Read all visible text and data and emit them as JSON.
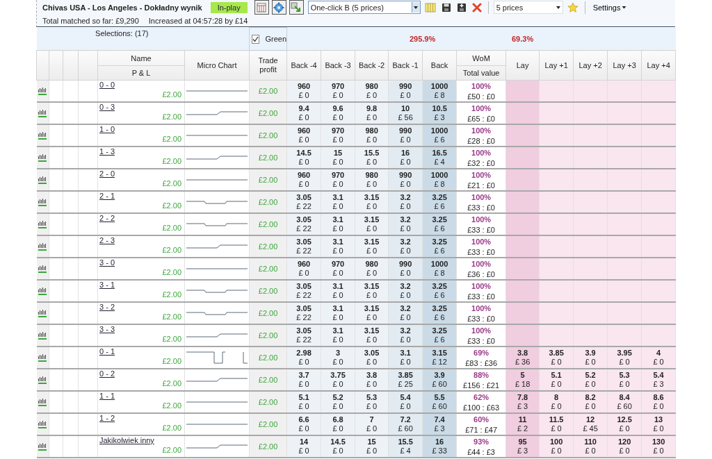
{
  "header": {
    "title": "Chivas USA - Los Angeles - Dokładny wynik",
    "status": "In-play",
    "strategy": "One-click B (5 prices)",
    "prices": "5 prices",
    "settings": "Settings",
    "total_matched": "Total matched so far: £9,290",
    "increased": "Increased at 04:57:28 by £14"
  },
  "summary": {
    "selections": "Selections: (17)",
    "green": {
      "label": "Green",
      "checked": true
    },
    "back_book": "295.9%",
    "lay_book": "69.3%"
  },
  "columns": {
    "name": "Name",
    "pl": "P & L",
    "micro_chart": "Micro Chart",
    "trade_profit": "Trade profit",
    "back": [
      "Back -4",
      "Back -3",
      "Back -2",
      "Back -1",
      "Back"
    ],
    "wom": "WoM",
    "total_value": "Total value",
    "lay": [
      "Lay",
      "Lay +1",
      "Lay +2",
      "Lay +3",
      "Lay +4"
    ]
  },
  "rows": [
    {
      "name": "0 - 0",
      "pl": "£2.00",
      "kind": "flat",
      "trade_profit": "£2.00",
      "back": [
        [
          "960",
          "£ 0"
        ],
        [
          "970",
          "£ 0"
        ],
        [
          "980",
          "£ 0"
        ],
        [
          "990",
          "£ 0"
        ],
        [
          "1000",
          "£ 8"
        ]
      ],
      "wom": "100%",
      "total": "£50 : £0"
    },
    {
      "name": "0 - 3",
      "pl": "£2.00",
      "kind": "step",
      "trade_profit": "£2.00",
      "back": [
        [
          "9.4",
          "£ 0"
        ],
        [
          "9.6",
          "£ 0"
        ],
        [
          "9.8",
          "£ 0"
        ],
        [
          "10",
          "£ 56"
        ],
        [
          "10.5",
          "£ 3"
        ]
      ],
      "wom": "100%",
      "total": "£65 : £0"
    },
    {
      "name": "1 - 0",
      "pl": "£2.00",
      "kind": "flat",
      "trade_profit": "£2.00",
      "back": [
        [
          "960",
          "£ 0"
        ],
        [
          "970",
          "£ 0"
        ],
        [
          "980",
          "£ 0"
        ],
        [
          "990",
          "£ 0"
        ],
        [
          "1000",
          "£ 6"
        ]
      ],
      "wom": "100%",
      "total": "£28 : £0"
    },
    {
      "name": "1 - 3",
      "pl": "£2.00",
      "kind": "step",
      "trade_profit": "£2.00",
      "back": [
        [
          "14.5",
          "£ 0"
        ],
        [
          "15",
          "£ 0"
        ],
        [
          "15.5",
          "£ 0"
        ],
        [
          "16",
          "£ 0"
        ],
        [
          "16.5",
          "£ 4"
        ]
      ],
      "wom": "100%",
      "total": "£32 : £0"
    },
    {
      "name": "2 - 0",
      "pl": "£2.00",
      "kind": "flat",
      "trade_profit": "£2.00",
      "back": [
        [
          "960",
          "£ 0"
        ],
        [
          "970",
          "£ 0"
        ],
        [
          "980",
          "£ 0"
        ],
        [
          "990",
          "£ 0"
        ],
        [
          "1000",
          "£ 8"
        ]
      ],
      "wom": "100%",
      "total": "£21 : £0"
    },
    {
      "name": "2 - 1",
      "pl": "£2.00",
      "kind": "notch",
      "trade_profit": "£2.00",
      "back": [
        [
          "3.05",
          "£ 22"
        ],
        [
          "3.1",
          "£ 0"
        ],
        [
          "3.15",
          "£ 0"
        ],
        [
          "3.2",
          "£ 0"
        ],
        [
          "3.25",
          "£ 6"
        ]
      ],
      "wom": "100%",
      "total": "£33 : £0"
    },
    {
      "name": "2 - 2",
      "pl": "£2.00",
      "kind": "notch",
      "trade_profit": "£2.00",
      "back": [
        [
          "3.05",
          "£ 22"
        ],
        [
          "3.1",
          "£ 0"
        ],
        [
          "3.15",
          "£ 0"
        ],
        [
          "3.2",
          "£ 0"
        ],
        [
          "3.25",
          "£ 6"
        ]
      ],
      "wom": "100%",
      "total": "£33 : £0"
    },
    {
      "name": "2 - 3",
      "pl": "£2.00",
      "kind": "step",
      "trade_profit": "£2.00",
      "back": [
        [
          "3.05",
          "£ 22"
        ],
        [
          "3.1",
          "£ 0"
        ],
        [
          "3.15",
          "£ 0"
        ],
        [
          "3.2",
          "£ 0"
        ],
        [
          "3.25",
          "£ 6"
        ]
      ],
      "wom": "100%",
      "total": "£33 : £0"
    },
    {
      "name": "3 - 0",
      "pl": "£2.00",
      "kind": "flat",
      "trade_profit": "£2.00",
      "back": [
        [
          "960",
          "£ 0"
        ],
        [
          "970",
          "£ 0"
        ],
        [
          "980",
          "£ 0"
        ],
        [
          "990",
          "£ 0"
        ],
        [
          "1000",
          "£ 8"
        ]
      ],
      "wom": "100%",
      "total": "£36 : £0"
    },
    {
      "name": "3 - 1",
      "pl": "£2.00",
      "kind": "notch",
      "trade_profit": "£2.00",
      "back": [
        [
          "3.05",
          "£ 22"
        ],
        [
          "3.1",
          "£ 0"
        ],
        [
          "3.15",
          "£ 0"
        ],
        [
          "3.2",
          "£ 0"
        ],
        [
          "3.25",
          "£ 6"
        ]
      ],
      "wom": "100%",
      "total": "£33 : £0"
    },
    {
      "name": "3 - 2",
      "pl": "£2.00",
      "kind": "notch",
      "trade_profit": "£2.00",
      "back": [
        [
          "3.05",
          "£ 22"
        ],
        [
          "3.1",
          "£ 0"
        ],
        [
          "3.15",
          "£ 0"
        ],
        [
          "3.2",
          "£ 0"
        ],
        [
          "3.25",
          "£ 6"
        ]
      ],
      "wom": "100%",
      "total": "£33 : £0"
    },
    {
      "name": "3 - 3",
      "pl": "£2.00",
      "kind": "step",
      "trade_profit": "£2.00",
      "back": [
        [
          "3.05",
          "£ 22"
        ],
        [
          "3.1",
          "£ 0"
        ],
        [
          "3.15",
          "£ 0"
        ],
        [
          "3.2",
          "£ 0"
        ],
        [
          "3.25",
          "£ 6"
        ]
      ],
      "wom": "100%",
      "total": "£33 : £0"
    },
    {
      "name": "0 - 1",
      "pl": "£2.00",
      "kind": "spike",
      "trade_profit": "£2.00",
      "back": [
        [
          "2.98",
          "£ 0"
        ],
        [
          "3",
          "£ 0"
        ],
        [
          "3.05",
          "£ 0"
        ],
        [
          "3.1",
          "£ 0"
        ],
        [
          "3.15",
          "£ 12"
        ]
      ],
      "wom": "69%",
      "total": "£83 : £36",
      "lay": [
        [
          "3.8",
          "£ 36"
        ],
        [
          "3.85",
          "£ 0"
        ],
        [
          "3.9",
          "£ 0"
        ],
        [
          "3.95",
          "£ 0"
        ],
        [
          "4",
          "£ 0"
        ]
      ]
    },
    {
      "name": "0 - 2",
      "pl": "£2.00",
      "kind": "step",
      "trade_profit": "£2.00",
      "back": [
        [
          "3.7",
          "£ 0"
        ],
        [
          "3.75",
          "£ 0"
        ],
        [
          "3.8",
          "£ 0"
        ],
        [
          "3.85",
          "£ 25"
        ],
        [
          "3.9",
          "£ 60"
        ]
      ],
      "wom": "88%",
      "total": "£156 : £21",
      "lay": [
        [
          "5",
          "£ 18"
        ],
        [
          "5.1",
          "£ 0"
        ],
        [
          "5.2",
          "£ 0"
        ],
        [
          "5.3",
          "£ 0"
        ],
        [
          "5.4",
          "£ 3"
        ]
      ]
    },
    {
      "name": "1 - 1",
      "pl": "£2.00",
      "kind": "flat",
      "trade_profit": "£2.00",
      "back": [
        [
          "5.1",
          "£ 0"
        ],
        [
          "5.2",
          "£ 0"
        ],
        [
          "5.3",
          "£ 0"
        ],
        [
          "5.4",
          "£ 0"
        ],
        [
          "5.5",
          "£ 60"
        ]
      ],
      "wom": "62%",
      "total": "£100 : £63",
      "lay": [
        [
          "7.8",
          "£ 3"
        ],
        [
          "8",
          "£ 0"
        ],
        [
          "8.2",
          "£ 0"
        ],
        [
          "8.4",
          "£ 60"
        ],
        [
          "8.6",
          "£ 0"
        ]
      ]
    },
    {
      "name": "1 - 2",
      "pl": "£2.00",
      "kind": "flat",
      "trade_profit": "£2.00",
      "back": [
        [
          "6.6",
          "£ 0"
        ],
        [
          "6.8",
          "£ 0"
        ],
        [
          "7",
          "£ 0"
        ],
        [
          "7.2",
          "£ 60"
        ],
        [
          "7.4",
          "£ 3"
        ]
      ],
      "wom": "60%",
      "total": "£71 : £47",
      "lay": [
        [
          "11",
          "£ 2"
        ],
        [
          "11.5",
          "£ 0"
        ],
        [
          "12",
          "£ 45"
        ],
        [
          "12.5",
          "£ 0"
        ],
        [
          "13",
          "£ 0"
        ]
      ]
    },
    {
      "name": "Jakikolwiek inny",
      "pl": "£2.00",
      "kind": "step",
      "trade_profit": "£2.00",
      "back": [
        [
          "14",
          "£ 0"
        ],
        [
          "14.5",
          "£ 0"
        ],
        [
          "15",
          "£ 0"
        ],
        [
          "15.5",
          "£ 4"
        ],
        [
          "16",
          "£ 33"
        ]
      ],
      "wom": "93%",
      "total": "£44 : £3",
      "lay": [
        [
          "95",
          "£ 3"
        ],
        [
          "100",
          "£ 0"
        ],
        [
          "110",
          "£ 0"
        ],
        [
          "120",
          "£ 0"
        ],
        [
          "130",
          "£ 0"
        ]
      ]
    }
  ]
}
